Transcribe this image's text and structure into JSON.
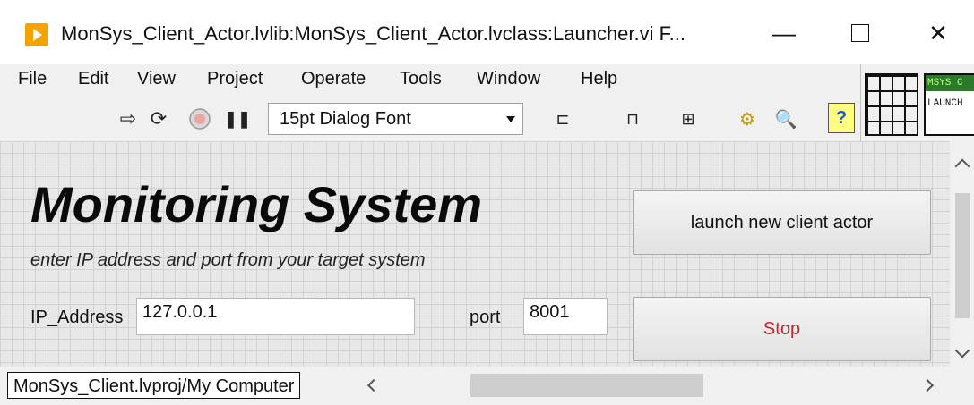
{
  "window": {
    "title": "MonSys_Client_Actor.lvlib:MonSys_Client_Actor.lvclass:Launcher.vi F...",
    "minimize_glyph": "—",
    "close_glyph": "✕"
  },
  "menu": [
    "File",
    "Edit",
    "View",
    "Project",
    "Operate",
    "Tools",
    "Window",
    "Help"
  ],
  "toolbar": {
    "run_glyph": "⇨",
    "run_continuous_glyph": "⟳",
    "pause_glyph": "❚❚",
    "font_select": "15pt Dialog Font",
    "align_glyph": "⊏",
    "distribute_glyph": "⊓",
    "resize_glyph": "⊞",
    "reorder_glyph": "⚙",
    "search_glyph": "🔍",
    "help_glyph": "?"
  },
  "vi_icon": {
    "top_text": "MSYS C",
    "bottom_text": "LAUNCH"
  },
  "panel": {
    "title": "Monitoring System",
    "subtitle": "enter IP address and port from your target system",
    "ip_label": "IP_Address",
    "ip_value": "127.0.0.1",
    "port_label": "port",
    "port_value": "8001",
    "launch_button": "launch new client actor",
    "stop_button": "Stop"
  },
  "status": {
    "context": "MonSys_Client.lvproj/My Computer"
  },
  "colors": {
    "accent_icon": "#f5a300",
    "stop_text": "#c0282d",
    "help_bg": "#ffff80"
  }
}
